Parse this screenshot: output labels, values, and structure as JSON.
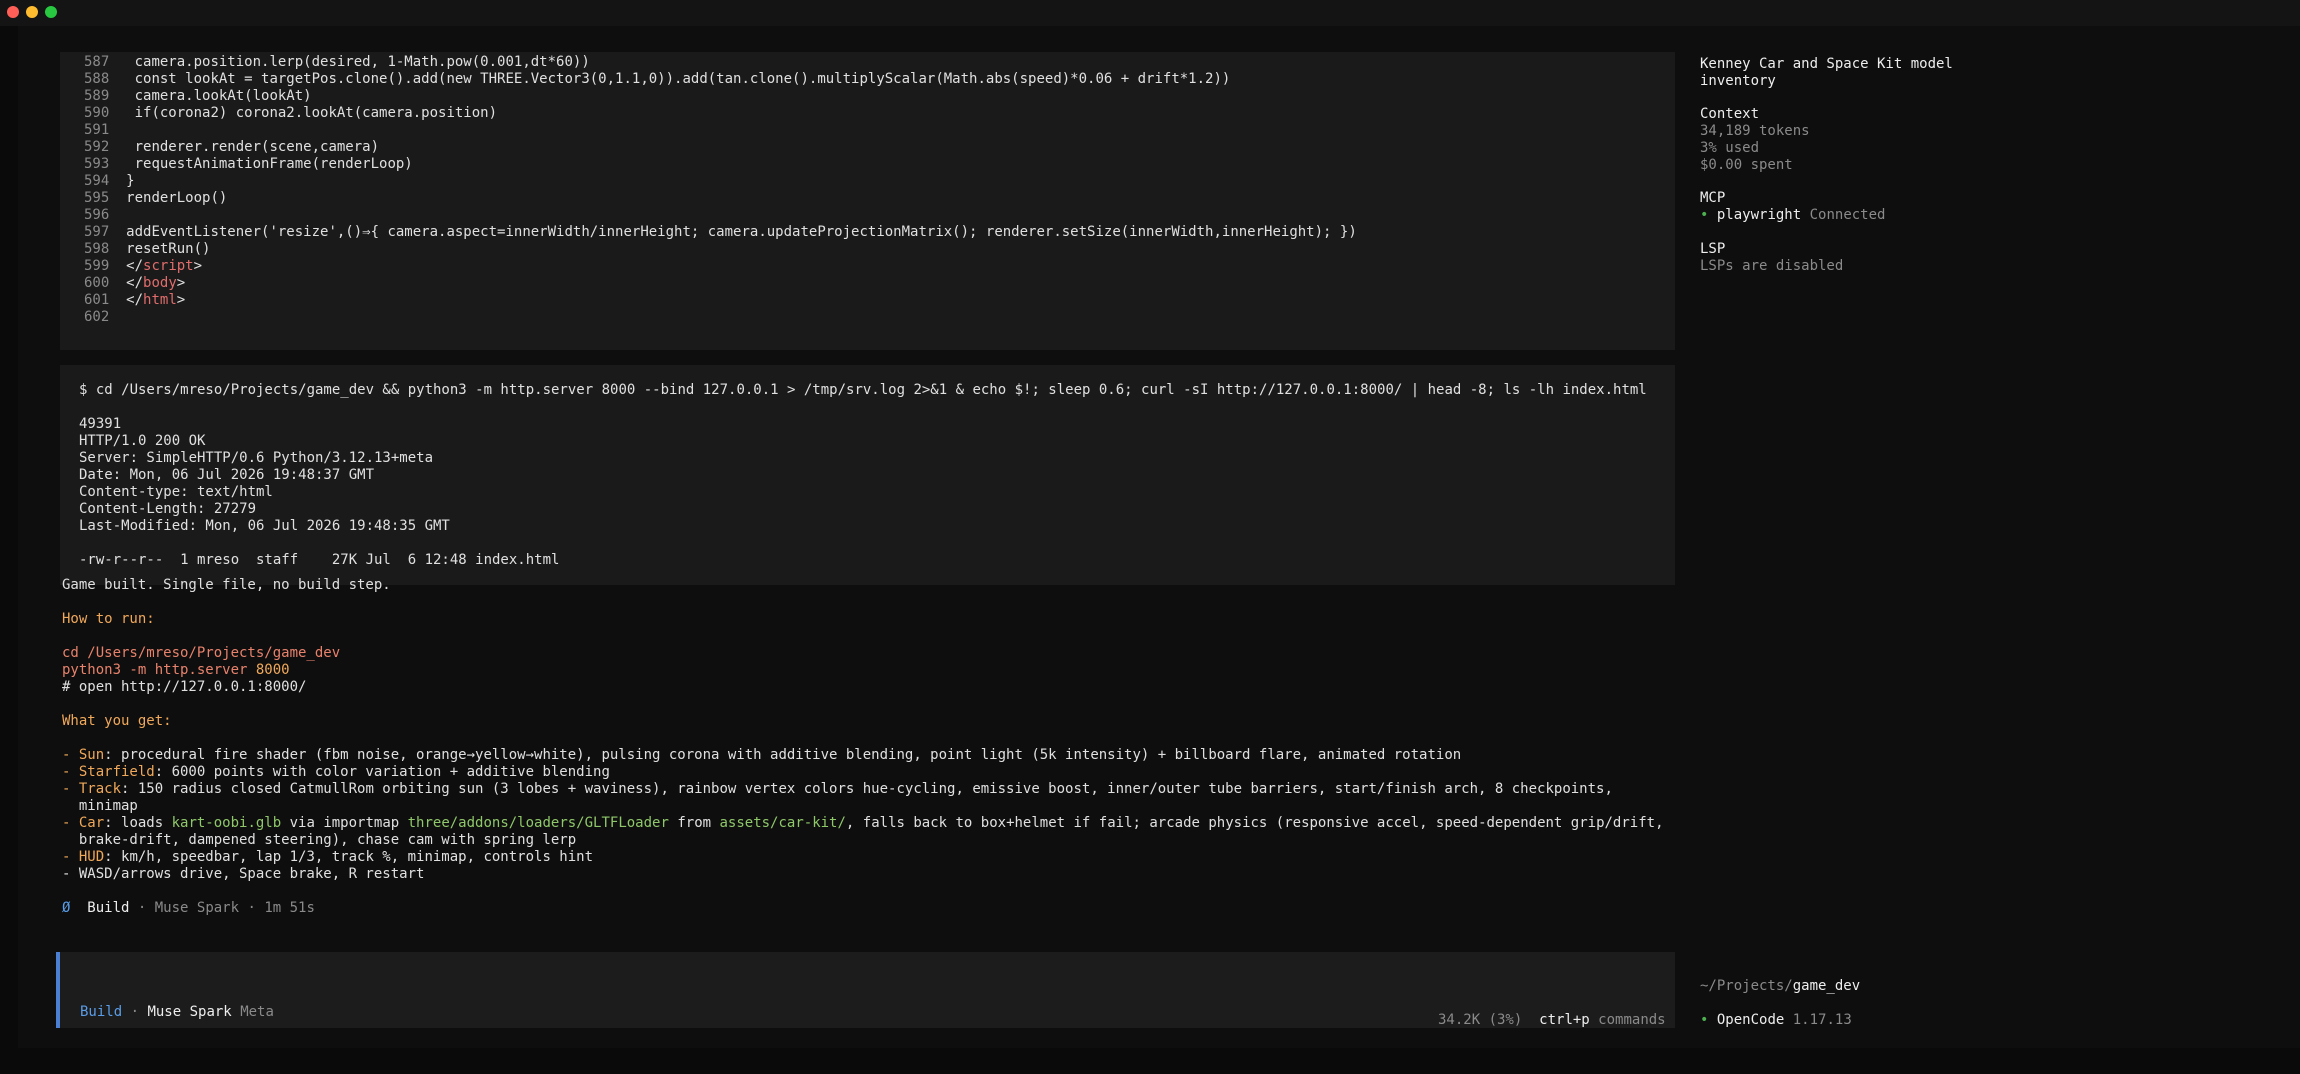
{
  "code_lines": [
    {
      "num": "587",
      "text": "  camera.position.lerp(desired, 1-Math.pow(0.001,dt*60))"
    },
    {
      "num": "588",
      "text": "  const lookAt = targetPos.clone().add(new THREE.Vector3(0,1.1,0)).add(tan.clone().multiplyScalar(Math.abs(speed)*0.06 + drift*1.2))"
    },
    {
      "num": "589",
      "text": "  camera.lookAt(lookAt)"
    },
    {
      "num": "590",
      "text": "  if(corona2) corona2.lookAt(camera.position)"
    },
    {
      "num": "591",
      "text": ""
    },
    {
      "num": "592",
      "text": "  renderer.render(scene,camera)"
    },
    {
      "num": "593",
      "text": "  requestAnimationFrame(renderLoop)"
    },
    {
      "num": "594",
      "text": " }"
    },
    {
      "num": "595",
      "text": " renderLoop()"
    },
    {
      "num": "596",
      "text": ""
    },
    {
      "num": "597",
      "text": " addEventListener('resize',()⇒{ camera.aspect=innerWidth/innerHeight; camera.updateProjectionMatrix(); renderer.setSize(innerWidth,innerHeight); })"
    },
    {
      "num": "598",
      "text": " resetRun()"
    },
    {
      "num": "599",
      "text": " </",
      "tag": "script",
      "close": ">"
    },
    {
      "num": "600",
      "text": " </",
      "tag": "body",
      "close": ">"
    },
    {
      "num": "601",
      "text": " </",
      "tag": "html",
      "close": ">"
    },
    {
      "num": "602",
      "text": ""
    }
  ],
  "command": "$ cd /Users/mreso/Projects/game_dev && python3 -m http.server 8000 --bind 127.0.0.1 > /tmp/srv.log 2>&1 & echo $!; sleep 0.6; curl -sI http://127.0.0.1:8000/ | head -8; ls -lh index.html",
  "output_lines": [
    "49391",
    "HTTP/1.0 200 OK",
    "Server: SimpleHTTP/0.6 Python/3.12.13+meta",
    "Date: Mon, 06 Jul 2026 19:48:37 GMT",
    "Content-type: text/html",
    "Content-Length: 27279",
    "Last-Modified: Mon, 06 Jul 2026 19:48:35 GMT",
    "",
    "-rw-r--r--  1 mreso  staff    27K Jul  6 12:48 index.html"
  ],
  "response": {
    "intro": "Game built. Single file, no build step.",
    "how_to_run": "How to run:",
    "run_cmd1": "cd /Users/mreso/Projects/game_dev",
    "run_cmd2_a": "python3 -m http.server ",
    "run_cmd2_b": "8000",
    "run_cmd3": "# open http://127.0.0.1:8000/",
    "what_you_get": "What you get:",
    "bullet_dash": "- ",
    "sun_label": "Sun",
    "sun_text": ": procedural fire shader (fbm noise, orange→yellow→white), pulsing corona with additive blending, point light (5k intensity) + billboard flare, animated rotation",
    "starfield_label": "Starfield",
    "starfield_text": ": 6000 points with color variation + additive blending",
    "track_label": "Track",
    "track_text1": ": 150 radius closed CatmullRom orbiting sun (3 lobes + waviness), rainbow vertex colors hue-cycling, emissive boost, inner/outer tube barriers, start/finish arch, 8 checkpoints,",
    "track_text2": "  minimap",
    "car_label": "Car",
    "car_t1": ": loads ",
    "car_file": "kart-oobi.glb",
    "car_t2": " via importmap ",
    "car_loader": "three/addons/loaders/GLTFLoader",
    "car_t3": " from ",
    "car_path": "assets/car-kit/",
    "car_t4": ", falls back to box+helmet if fail; arcade physics (responsive accel, speed-dependent grip/drift,",
    "car_text2": "  brake-drift, dampened steering), chase cam with spring lerp",
    "hud_label": "HUD",
    "hud_text": ": km/h, speedbar, lap 1/3, track %, minimap, controls hint",
    "wasd_text": "- WASD/arrows drive, Space brake, R restart"
  },
  "status": {
    "glyph": "Ø",
    "agent": "Build",
    "sep": " · ",
    "model": "Muse Spark",
    "sep2": " · ",
    "time": "1m 51s"
  },
  "prompt": {
    "mode": "Build",
    "sep": " · ",
    "model": "Muse Spark",
    "provider": "Meta"
  },
  "footer": {
    "usage": "34.2K (3%)",
    "shortcut": "ctrl+p",
    "shortcut_label": "commands"
  },
  "sidebar": {
    "title_line1": "Kenney Car and Space Kit model",
    "title_line2": "inventory",
    "context_heading": "Context",
    "tokens": "34,189 tokens",
    "used": "3% used",
    "spent": "$0.00 spent",
    "mcp_heading": "MCP",
    "mcp_bullet": "•",
    "mcp_name": "playwright",
    "mcp_status": "Connected",
    "lsp_heading": "LSP",
    "lsp_status": "LSPs are disabled",
    "path_prefix": "~/Projects/",
    "path_dir": "game_dev",
    "app_bullet": "•",
    "app_name": "OpenCode",
    "app_version": "1.17.13"
  },
  "colors": {
    "accent_blue": "#4a7fd4",
    "heading_orange": "#f0a85a",
    "command_salmon": "#e8826c",
    "path_green": "#8fc86a",
    "mcp_green": "#4caf50"
  }
}
